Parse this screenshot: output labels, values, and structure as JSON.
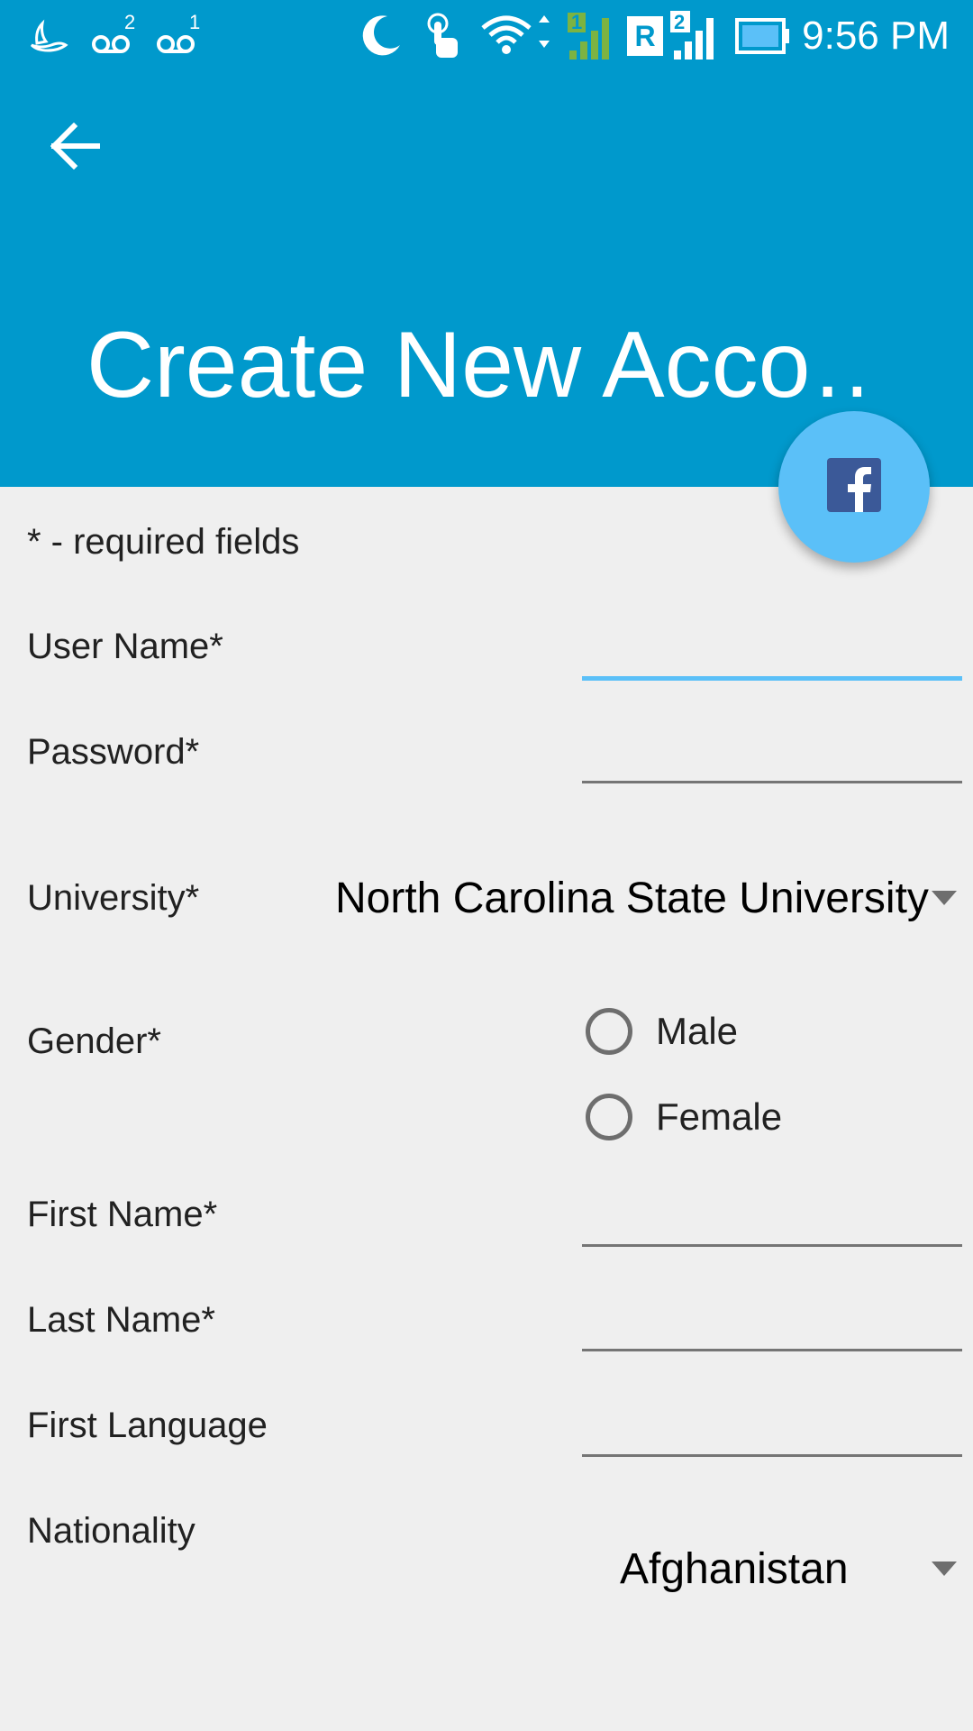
{
  "status_bar": {
    "time": "9:56 PM",
    "voicemail_1_count": "2",
    "voicemail_2_count": "1",
    "sim1_label": "1",
    "roaming_label": "R",
    "sim2_label": "2",
    "icons": [
      "bird-notification-icon",
      "voicemail-icon",
      "voicemail-icon",
      "moon-icon",
      "touch-icon",
      "wifi-icon",
      "signal-sim1-icon",
      "roaming-icon",
      "signal-sim2-icon",
      "battery-icon"
    ]
  },
  "header": {
    "title": "Create New Acco…",
    "back_icon": "arrow-back-icon",
    "background_color": "#0099CC"
  },
  "fab": {
    "icon": "facebook-icon",
    "color": "#5BC0F8"
  },
  "form": {
    "required_note": "* - required fields",
    "username_label": "User Name*",
    "username_value": "",
    "password_label": "Password*",
    "password_value": "",
    "university_label": "University*",
    "university_value": "North Carolina State University",
    "gender_label": "Gender*",
    "gender_options": [
      "Male",
      "Female"
    ],
    "first_name_label": "First Name*",
    "first_name_value": "",
    "last_name_label": "Last Name*",
    "last_name_value": "",
    "first_language_label": "First Language",
    "first_language_value": "",
    "nationality_label": "Nationality",
    "nationality_value": "Afghanistan"
  }
}
